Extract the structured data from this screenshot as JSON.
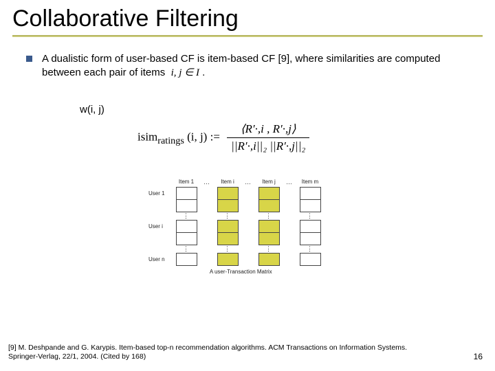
{
  "title": "Collaborative Filtering",
  "bullet": {
    "pre": "A dualistic form of user-based CF is ",
    "em": "item-based CF",
    "post1": " [9], where similarities are computed between each pair of items ",
    "ij": "i, j ∈ I",
    "post2": " ."
  },
  "weight_label": "w(i, j)",
  "formula": {
    "lhs": "isim",
    "sub": "ratings",
    "args": "(i, j) :=",
    "num": "⟨R′·,i , R′·,j⟩",
    "den": "||R′·,i||₂ ||R′·,j||₂"
  },
  "matrix": {
    "cols": [
      "Item 1",
      "Item i",
      "Item j",
      "Item m"
    ],
    "rows": [
      "User 1",
      "User i",
      "User n"
    ],
    "caption": "A user-Transaction Matrix"
  },
  "reference": "[9] M. Deshpande and G. Karypis. Item-based top-n recommendation algorithms. ACM Transactions on Information Systems. Springer-Verlag, 22/1, 2004. (Cited by 168)",
  "page": "16"
}
